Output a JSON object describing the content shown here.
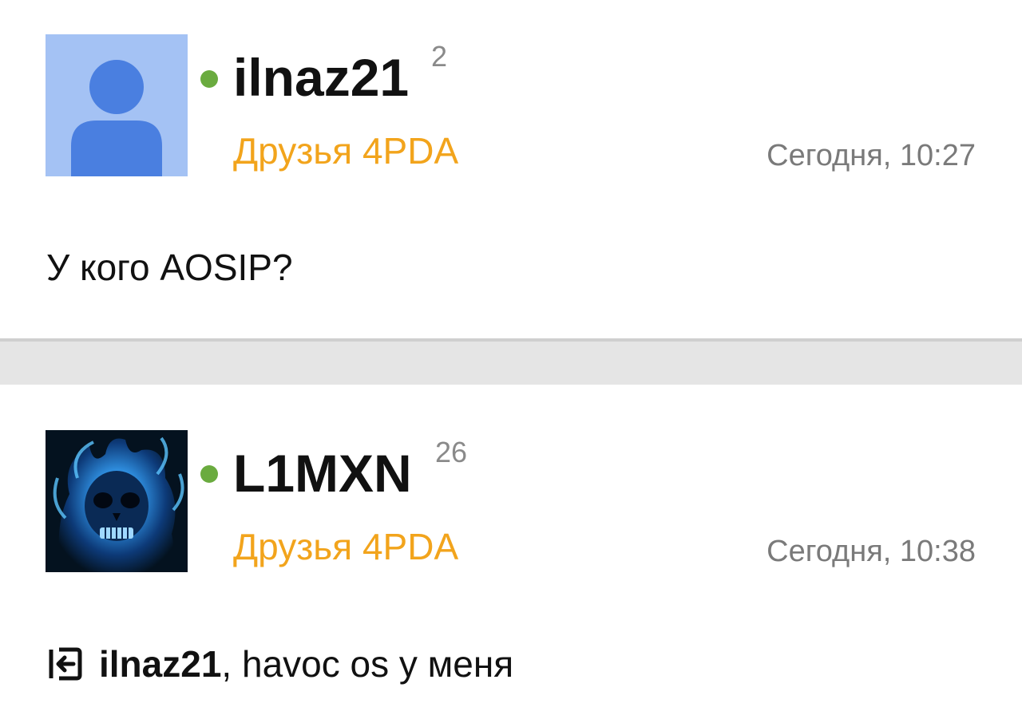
{
  "posts": [
    {
      "nickname": "ilnaz21",
      "reputation": "2",
      "group": "Друзья 4PDA",
      "time": "Сегодня, 10:27",
      "text": "У кого AOSIP?",
      "avatar": "default-avatar-icon",
      "online": true
    },
    {
      "nickname": "L1MXN",
      "reputation": "26",
      "group": "Друзья 4PDA",
      "time": "Сегодня, 10:38",
      "mention": "ilnaz21",
      "text": ", havoc os у меня",
      "avatar": "blue-flaming-skull-image",
      "online": true,
      "icon": "reply-arrow-icon"
    }
  ],
  "colors": {
    "online": "#6aab3f",
    "group": "#f2a41c",
    "time": "#7a7a7a",
    "separator": "#e5e5e5",
    "avatar_bg": "#a4c2f4",
    "avatar_figure": "#4a7fe0"
  }
}
